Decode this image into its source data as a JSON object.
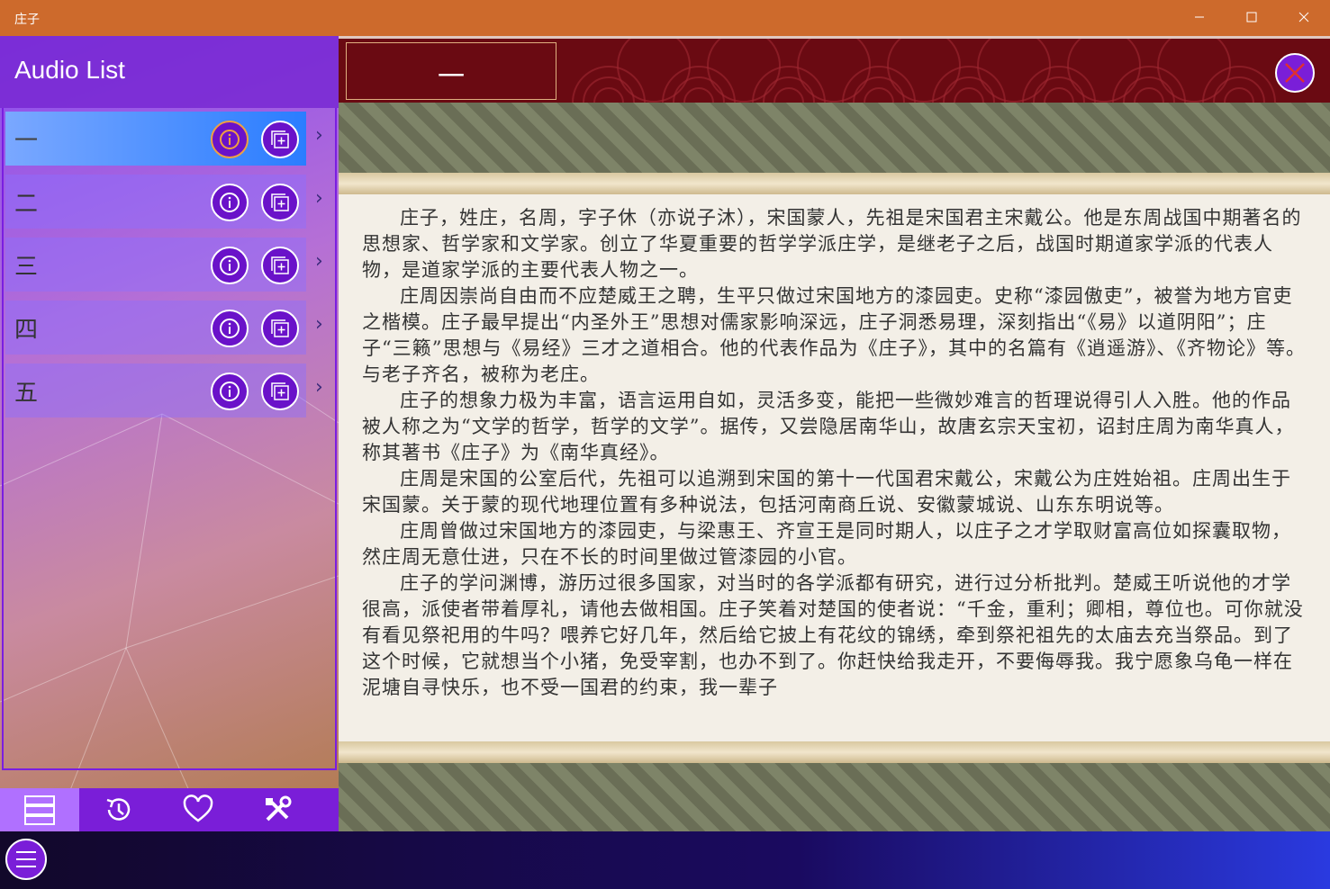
{
  "window": {
    "title": "庄子"
  },
  "sidebar": {
    "title": "Audio List",
    "items": [
      {
        "label": "一",
        "active": true
      },
      {
        "label": "二",
        "active": false
      },
      {
        "label": "三",
        "active": false
      },
      {
        "label": "四",
        "active": false
      },
      {
        "label": "五",
        "active": false
      }
    ],
    "nav": [
      "list-icon",
      "history-icon",
      "heart-icon",
      "tools-icon"
    ]
  },
  "content": {
    "chapter_title": "一",
    "paragraphs": [
      "庄子，姓庄，名周，字子休（亦说子沐），宋国蒙人，先祖是宋国君主宋戴公。他是东周战国中期著名的思想家、哲学家和文学家。创立了华夏重要的哲学学派庄学，是继老子之后，战国时期道家学派的代表人物，是道家学派的主要代表人物之一。",
      "庄周因崇尚自由而不应楚威王之聘，生平只做过宋国地方的漆园吏。史称“漆园傲吏”，被誉为地方官吏之楷模。庄子最早提出“内圣外王”思想对儒家影响深远，庄子洞悉易理，深刻指出“《易》以道阴阳”；庄子“三籁”思想与《易经》三才之道相合。他的代表作品为《庄子》，其中的名篇有《逍遥游》、《齐物论》等。与老子齐名，被称为老庄。",
      "庄子的想象力极为丰富，语言运用自如，灵活多变，能把一些微妙难言的哲理说得引人入胜。他的作品被人称之为“文学的哲学，哲学的文学”。据传，又尝隐居南华山，故唐玄宗天宝初，诏封庄周为南华真人，称其著书《庄子》为《南华真经》。",
      "庄周是宋国的公室后代，先祖可以追溯到宋国的第十一代国君宋戴公，宋戴公为庄姓始祖。庄周出生于宋国蒙。关于蒙的现代地理位置有多种说法，包括河南商丘说、安徽蒙城说、山东东明说等。",
      "庄周曾做过宋国地方的漆园吏，与梁惠王、齐宣王是同时期人，以庄子之才学取财富高位如探囊取物，然庄周无意仕进，只在不长的时间里做过管漆园的小官。",
      "庄子的学问渊博，游历过很多国家，对当时的各学派都有研究，进行过分析批判。楚威王听说他的才学很高，派使者带着厚礼，请他去做相国。庄子笑着对楚国的使者说：“千金，重利；卿相，尊位也。可你就没有看见祭祀用的牛吗？喂养它好几年，然后给它披上有花纹的锦绣，牵到祭祀祖先的太庙去充当祭品。到了这个时候，它就想当个小猪，免受宰割，也办不到了。你赶快给我走开，不要侮辱我。我宁愿象乌龟一样在泥塘自寻快乐，也不受一国君的约束，我一辈子"
    ]
  },
  "colors": {
    "titlebar": "#cd6a2c",
    "accent": "#7a1ed8",
    "topbar": "#6a0a12"
  }
}
